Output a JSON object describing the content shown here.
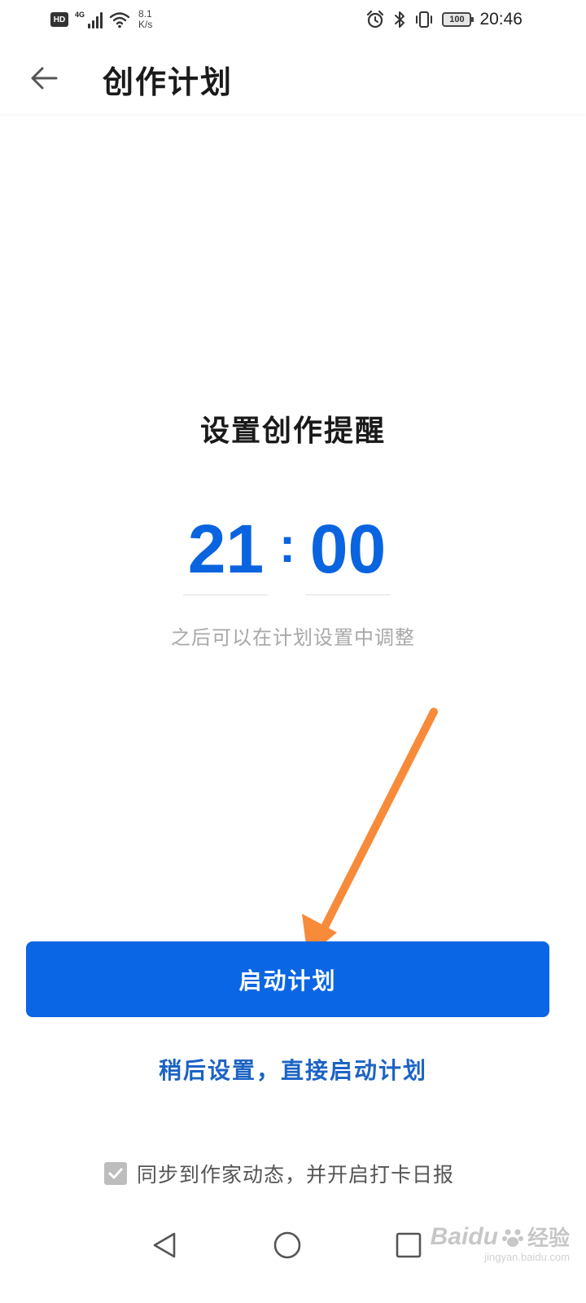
{
  "status_bar": {
    "hd_badge": "HD",
    "network": "4G",
    "speed_value": "8.1",
    "speed_unit": "K/s",
    "battery": "100",
    "time": "20:46"
  },
  "header": {
    "title": "创作计划"
  },
  "reminder": {
    "title": "设置创作提醒",
    "hour": "21",
    "minute": "00",
    "hint": "之后可以在计划设置中调整"
  },
  "actions": {
    "start_plan_label": "启动计划",
    "later_label": "稍后设置，直接启动计划"
  },
  "sync": {
    "label": "同步到作家动态，并开启打卡日报",
    "checked": true
  },
  "watermark": {
    "brand": "Baidu",
    "brand_suffix": "经验",
    "url": "jingyan.baidu.com"
  },
  "colors": {
    "accent": "#0a66e4",
    "link": "#1c63c4",
    "arrow": "#f78b3a"
  }
}
